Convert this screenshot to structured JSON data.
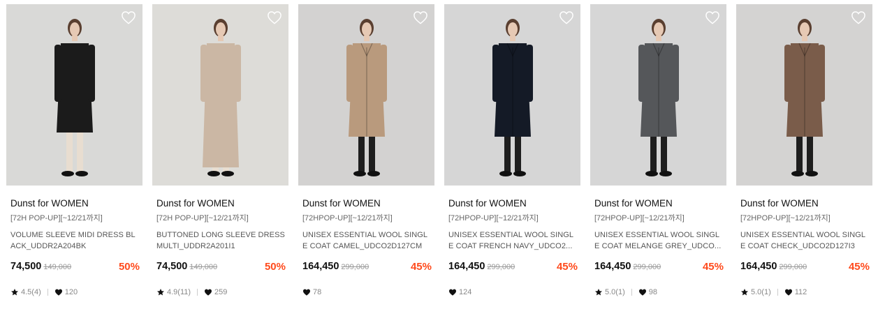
{
  "products": [
    {
      "brand": "Dunst for WOMEN",
      "badge": "[72H POP-UP][~12/21까지]",
      "name": "VOLUME SLEEVE MIDI DRESS BLACK_UDDR2A204BK",
      "price": "74,500",
      "original_price": "149,000",
      "discount": "50%",
      "rating": "4.5(4)",
      "likes": "120",
      "bg": "#d9d9d7",
      "garment": "#1b1b1b",
      "style": "dress"
    },
    {
      "brand": "Dunst for WOMEN",
      "badge": "[72H POP-UP][~12/21까지]",
      "name": "BUTTONED LONG SLEEVE DRESS MULTI_UDDR2A201I1",
      "price": "74,500",
      "original_price": "149,000",
      "discount": "50%",
      "rating": "4.9(11)",
      "likes": "259",
      "bg": "#dddcd8",
      "garment": "#cbb7a4",
      "style": "longdress"
    },
    {
      "brand": "Dunst for WOMEN",
      "badge": "[72HPOP-UP][~12/21까지]",
      "name": "UNISEX ESSENTIAL WOOL SINGLE COAT CAMEL_UDCO2D127CM",
      "price": "164,450",
      "original_price": "299,000",
      "discount": "45%",
      "rating": "",
      "likes": "78",
      "bg": "#d3d2d1",
      "garment": "#b99a7d",
      "style": "coat"
    },
    {
      "brand": "Dunst for WOMEN",
      "badge": "[72HPOP-UP][~12/21까지]",
      "name": "UNISEX ESSENTIAL WOOL SINGLE COAT FRENCH NAVY_UDCO2...",
      "price": "164,450",
      "original_price": "299,000",
      "discount": "45%",
      "rating": "",
      "likes": "124",
      "bg": "#d6d6d6",
      "garment": "#141a26",
      "style": "coat"
    },
    {
      "brand": "Dunst for WOMEN",
      "badge": "[72HPOP-UP][~12/21까지]",
      "name": "UNISEX ESSENTIAL WOOL SINGLE COAT MELANGE GREY_UDCO...",
      "price": "164,450",
      "original_price": "299,000",
      "discount": "45%",
      "rating": "5.0(1)",
      "likes": "98",
      "bg": "#d6d6d6",
      "garment": "#55575a",
      "style": "coat"
    },
    {
      "brand": "Dunst for WOMEN",
      "badge": "[72HPOP-UP][~12/21까지]",
      "name": "UNISEX ESSENTIAL WOOL SINGLE COAT CHECK_UDCO2D127I3",
      "price": "164,450",
      "original_price": "299,000",
      "discount": "45%",
      "rating": "5.0(1)",
      "likes": "112",
      "bg": "#d4d3d2",
      "garment": "#7a5c4a",
      "style": "coat"
    }
  ],
  "colors": {
    "discount": "#ff4a1c",
    "price": "#111111",
    "muted": "#888888"
  },
  "icons": {
    "wishlist": "heart-outline-icon",
    "rating": "star-icon",
    "likes": "heart-filled-icon"
  }
}
